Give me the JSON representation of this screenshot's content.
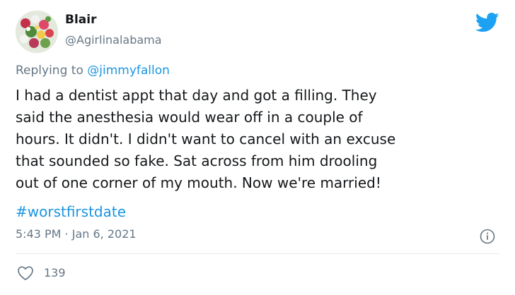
{
  "user": {
    "display_name": "Blair",
    "handle": "@Agirlinalabama"
  },
  "reply": {
    "prefix": "Replying to ",
    "mention": "@jimmyfallon"
  },
  "tweet": {
    "text": "I had a dentist appt that day and got a filling. They\nsaid the anesthesia would wear off in a couple of\nhours. It didn't. I didn't want to cancel with an excuse\nthat sounded so fake. Sat across from him drooling\nout of one corner of my mouth. Now we're married!",
    "hashtag": "#worstfirstdate",
    "timestamp": "5:43 PM · Jan 6, 2021",
    "likes": "139"
  },
  "colors": {
    "brand": "#1da1f2",
    "link": "#1b95e0",
    "muted": "#657786",
    "text": "#14171a"
  },
  "icons": {
    "brand": "twitter-bird-icon",
    "info": "info-icon",
    "like": "heart-icon"
  }
}
